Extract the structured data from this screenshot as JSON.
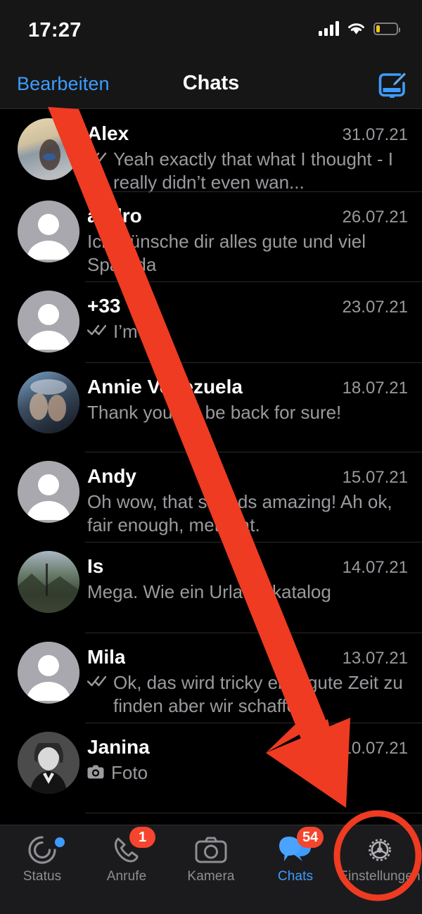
{
  "status_bar": {
    "time": "17:27",
    "signal_icon": "cellular-signal-icon",
    "wifi_icon": "wifi-icon",
    "battery_icon": "battery-low-icon"
  },
  "nav_bar": {
    "edit_label": "Bearbeiten",
    "title": "Chats",
    "compose_icon": "compose-new-chat-icon",
    "accent_color": "#3d9cff"
  },
  "chats": [
    {
      "name": "Alex",
      "date": "31.07.21",
      "message": "Yeah exactly that what I thought - I really didn’t even wan...",
      "read_receipt": "double-check-icon",
      "avatar_type": "photo",
      "avatar_name": "avatar-alex"
    },
    {
      "name": "andro",
      "date": "26.07.21",
      "message": "Ich wünsche dir alles gute und viel Spaß da",
      "read_receipt": "",
      "avatar_type": "placeholder",
      "avatar_name": "avatar-andro"
    },
    {
      "name": "+33",
      "date": "23.07.21",
      "message": "I’m ea",
      "read_receipt": "double-check-icon",
      "avatar_type": "placeholder",
      "avatar_name": "avatar-plus33"
    },
    {
      "name": "Annie Venezuela",
      "date": "18.07.21",
      "message": "Thank you, I’ll be back for sure!",
      "read_receipt": "",
      "avatar_type": "photo",
      "avatar_name": "avatar-annie-venezuela"
    },
    {
      "name": "Andy",
      "date": "15.07.21",
      "message": "Oh wow, that sounds amazing! Ah ok, fair enough, met that.",
      "read_receipt": "",
      "avatar_type": "placeholder",
      "avatar_name": "avatar-andy"
    },
    {
      "name": "Is",
      "date": "14.07.21",
      "message": "Mega. Wie ein Urlaubskatalog",
      "read_receipt": "",
      "avatar_type": "photo",
      "avatar_name": "avatar-is"
    },
    {
      "name": "Mila",
      "date": "13.07.21",
      "message": "Ok, das wird tricky eine gute Zeit zu finden aber wir schaffe...",
      "read_receipt": "double-check-icon",
      "avatar_type": "placeholder",
      "avatar_name": "avatar-mila"
    },
    {
      "name": "Janina",
      "date": "10.07.21",
      "message": "Foto",
      "read_receipt": "",
      "attachment_icon": "camera-icon",
      "avatar_type": "photo",
      "avatar_name": "avatar-janina"
    }
  ],
  "tab_bar": {
    "items": [
      {
        "label": "Status",
        "icon": "status-ring-icon",
        "badge": "",
        "dot": true,
        "active": false
      },
      {
        "label": "Anrufe",
        "icon": "phone-icon",
        "badge": "1",
        "dot": false,
        "active": false
      },
      {
        "label": "Kamera",
        "icon": "camera-icon",
        "badge": "",
        "dot": false,
        "active": false
      },
      {
        "label": "Chats",
        "icon": "chat-bubbles-icon",
        "badge": "54",
        "dot": false,
        "active": true
      },
      {
        "label": "Einstellungen",
        "icon": "gear-icon",
        "badge": "",
        "dot": false,
        "active": false
      }
    ],
    "badge_color": "#f5452e",
    "active_color": "#3d9cff",
    "inactive_color": "#8e8e93"
  },
  "annotations": {
    "arrow_color": "#ee3b22",
    "highlight_circle_color": "#ee3b22",
    "arrow_from": "chat-list-top-left",
    "arrow_to": "settings-tab",
    "circle_target": "settings-tab"
  }
}
